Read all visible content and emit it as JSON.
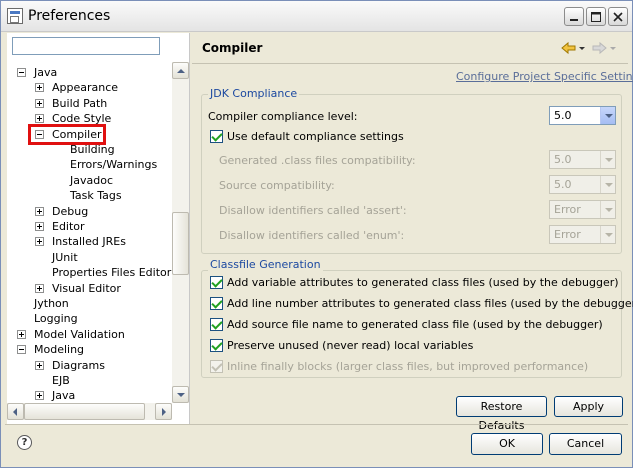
{
  "window": {
    "title": "Preferences",
    "minimize": "_",
    "maximize": "□",
    "close": "✕"
  },
  "filter": {
    "value": "",
    "placeholder": ""
  },
  "tree": [
    {
      "label": "Java",
      "expander": "minus",
      "level": 0
    },
    {
      "label": "Appearance",
      "expander": "plus",
      "level": 1
    },
    {
      "label": "Build Path",
      "expander": "plus",
      "level": 1
    },
    {
      "label": "Code Style",
      "expander": "plus",
      "level": 1
    },
    {
      "label": "Compiler",
      "expander": "minus",
      "level": 1,
      "selected": true
    },
    {
      "label": "Building",
      "expander": "",
      "level": 2
    },
    {
      "label": "Errors/Warnings",
      "expander": "",
      "level": 2
    },
    {
      "label": "Javadoc",
      "expander": "",
      "level": 2
    },
    {
      "label": "Task Tags",
      "expander": "",
      "level": 2
    },
    {
      "label": "Debug",
      "expander": "plus",
      "level": 1
    },
    {
      "label": "Editor",
      "expander": "plus",
      "level": 1
    },
    {
      "label": "Installed JREs",
      "expander": "plus",
      "level": 1
    },
    {
      "label": "JUnit",
      "expander": "",
      "level": 1
    },
    {
      "label": "Properties Files Editor",
      "expander": "",
      "level": 1
    },
    {
      "label": "Visual Editor",
      "expander": "plus",
      "level": 1
    },
    {
      "label": "Jython",
      "expander": "",
      "level": 0
    },
    {
      "label": "Logging",
      "expander": "",
      "level": 0
    },
    {
      "label": "Model Validation",
      "expander": "plus",
      "level": 0
    },
    {
      "label": "Modeling",
      "expander": "minus",
      "level": 0
    },
    {
      "label": "Diagrams",
      "expander": "plus",
      "level": 1
    },
    {
      "label": "EJB",
      "expander": "",
      "level": 1
    },
    {
      "label": "Java",
      "expander": "plus",
      "level": 1
    }
  ],
  "page": {
    "title": "Compiler",
    "configure_link": "Configure Project Specific Settings...",
    "jdk_group": {
      "legend": "JDK Compliance",
      "compliance_level_label": "Compiler compliance level:",
      "compliance_level_value": "5.0",
      "use_default_label": "Use default compliance settings",
      "use_default_checked": true,
      "rows": [
        {
          "label": "Generated .class files compatibility:",
          "value": "5.0"
        },
        {
          "label": "Source compatibility:",
          "value": "5.0"
        },
        {
          "label": "Disallow identifiers called 'assert':",
          "value": "Error"
        },
        {
          "label": "Disallow identifiers called 'enum':",
          "value": "Error"
        }
      ]
    },
    "classfile_group": {
      "legend": "Classfile Generation",
      "options": [
        {
          "label": "Add variable attributes to generated class files (used by the debugger)",
          "checked": true,
          "disabled": false
        },
        {
          "label": "Add line number attributes to generated class files (used by the debugger)",
          "checked": true,
          "disabled": false
        },
        {
          "label": "Add source file name to generated class file (used by the debugger)",
          "checked": true,
          "disabled": false
        },
        {
          "label": "Preserve unused (never read) local variables",
          "checked": true,
          "disabled": false
        },
        {
          "label": "Inline finally blocks (larger class files, but improved performance)",
          "checked": true,
          "disabled": true
        }
      ]
    },
    "restore_defaults_label": "Restore Defaults",
    "apply_label": "Apply"
  },
  "footer": {
    "help_label": "?",
    "ok_label": "OK",
    "cancel_label": "Cancel"
  },
  "colors": {
    "highlight": "#e01010",
    "legend": "#1c49a0",
    "link": "#5a6e99"
  }
}
